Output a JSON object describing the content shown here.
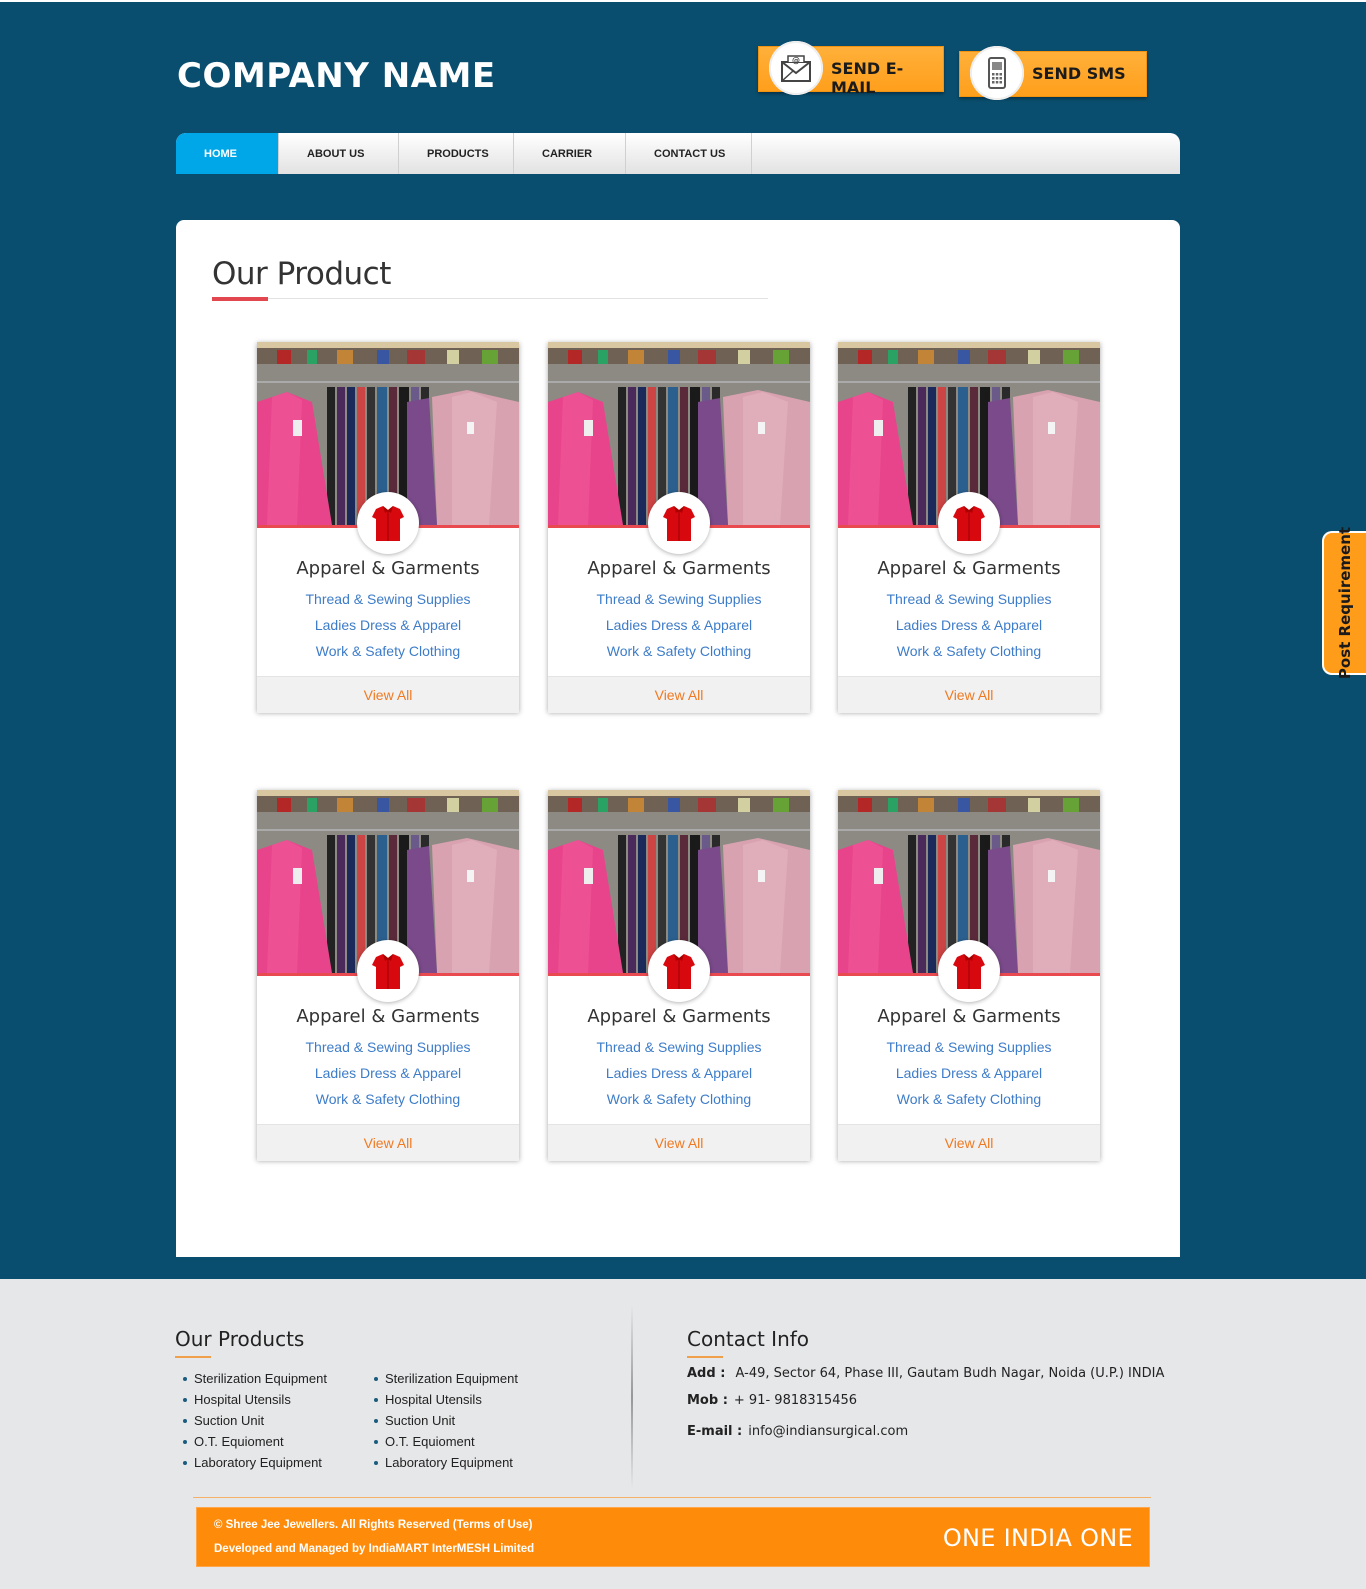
{
  "header": {
    "company_name": "COMPANY NAME",
    "send_email_label": "SEND E-MAIL",
    "send_sms_label": "SEND SMS"
  },
  "nav": {
    "items": [
      {
        "label": "HOME",
        "active": true
      },
      {
        "label": "ABOUT US",
        "active": false
      },
      {
        "label": "PRODUCTS",
        "active": false
      },
      {
        "label": "CARRIER",
        "active": false
      },
      {
        "label": "CONTACT US",
        "active": false
      }
    ]
  },
  "main": {
    "section_title": "Our Product",
    "cards": [
      {
        "title": "Apparel & Garments",
        "links": [
          "Thread & Sewing Supplies",
          "Ladies Dress & Apparel",
          "Work & Safety Clothing"
        ],
        "view_all": "View All"
      },
      {
        "title": "Apparel & Garments",
        "links": [
          "Thread & Sewing Supplies",
          "Ladies Dress & Apparel",
          "Work & Safety Clothing"
        ],
        "view_all": "View All"
      },
      {
        "title": "Apparel & Garments",
        "links": [
          "Thread & Sewing Supplies",
          "Ladies Dress & Apparel",
          "Work & Safety Clothing"
        ],
        "view_all": "View All"
      },
      {
        "title": "Apparel & Garments",
        "links": [
          "Thread & Sewing Supplies",
          "Ladies Dress & Apparel",
          "Work & Safety Clothing"
        ],
        "view_all": "View All"
      },
      {
        "title": "Apparel & Garments",
        "links": [
          "Thread & Sewing Supplies",
          "Ladies Dress & Apparel",
          "Work & Safety Clothing"
        ],
        "view_all": "View All"
      },
      {
        "title": "Apparel & Garments",
        "links": [
          "Thread & Sewing Supplies",
          "Ladies Dress & Apparel",
          "Work & Safety Clothing"
        ],
        "view_all": "View All"
      }
    ]
  },
  "side_tab": {
    "label": "Post Requirement"
  },
  "footer": {
    "products_title": "Our Products",
    "products_col1": [
      "Sterilization Equipment",
      "Hospital Utensils",
      "Suction Unit",
      "O.T. Equioment",
      "Laboratory Equipment"
    ],
    "products_col2": [
      "Sterilization Equipment",
      "Hospital Utensils",
      "Suction Unit",
      "O.T. Equioment",
      "Laboratory Equipment"
    ],
    "contact_title": "Contact Info",
    "address_label": "Add :",
    "address_value": "A-49, Sector 64, Phase III, Gautam Budh Nagar, Noida (U.P.) INDIA",
    "mobile_label": "Mob :",
    "mobile_value": "+ 91- 9818315456",
    "email_label": "E-mail :",
    "email_value": "info@indiansurgical.com",
    "copyright": "© Shree Jee Jewellers. All Rights Reserved (Terms of Use)",
    "developed_by": "Developed and Managed by IndiaMART InterMESH Limited",
    "brand": "ONE INDIA ONE"
  },
  "colors": {
    "header_bg": "#0a4e6f",
    "nav_active": "#00a7e8",
    "cta_orange": "#ff9f1c",
    "accent_red": "#e84a50",
    "link_blue": "#3d7cc9",
    "view_all_orange": "#f07a22",
    "footer_bar": "#ff8b0b"
  },
  "icons": [
    "envelope-icon",
    "mobile-phone-icon",
    "shirt-icon"
  ]
}
